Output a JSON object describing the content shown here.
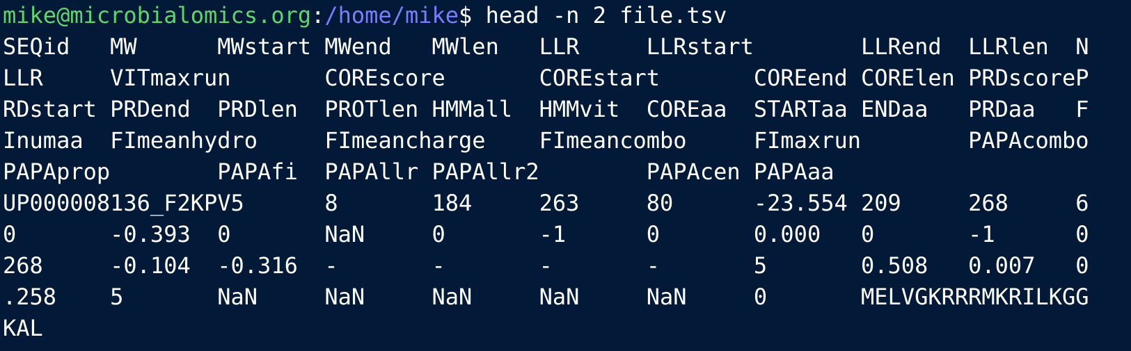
{
  "terminal": {
    "background": "#021a37",
    "text_color": "#ffffff",
    "prompt": {
      "user_host": "mike@microbialomics.org",
      "separator": ":",
      "path": "/home/mike",
      "symbol": "$",
      "command": "head -n 2 file.tsv",
      "user_host_color": "#5fd66a",
      "path_color": "#7b7dff"
    },
    "output": [
      "SEQid   MW      MWstart MWend   MWlen   LLR     LLRstart        LLRend  LLRlen  N",
      "LLR     VITmaxrun       COREscore       COREstart       COREend CORElen PRDscoreP",
      "RDstart PRDend  PRDlen  PROTlen HMMall  HMMvit  COREaa  STARTaa ENDaa   PRDaa   F",
      "Inumaa  FImeanhydro     FImeancharge    FImeancombo     FImaxrun        PAPAcombo",
      "PAPAprop        PAPAfi  PAPAllr PAPAllr2        PAPAcen PAPAaa",
      "UP000008136_F2KPV5      8       184     263     80      -23.554 209     268     6",
      "0       -0.393  0       NaN     0       -1      0       0.000   0       -1      0",
      "268     -0.104  -0.316  -       -       -       -       5       0.508   0.007   0",
      ".258    5       NaN     NaN     NaN     NaN     NaN     0       MELVGKRRRMKRILKGG",
      "KAL"
    ]
  }
}
